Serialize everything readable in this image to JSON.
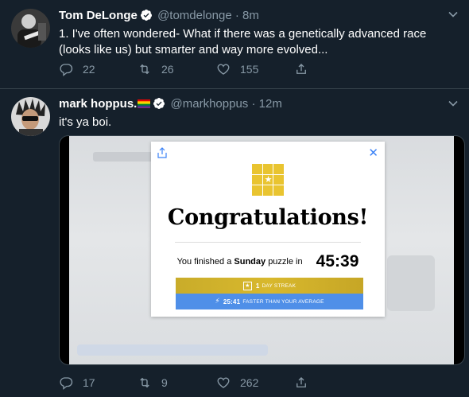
{
  "tweets": [
    {
      "name": "Tom DeLonge",
      "handle": "@tomdelonge",
      "time": "8m",
      "text": "1. I've often wondered- What if there was a genetically advanced race (looks like us) but smarter and way more evolved...",
      "replies": "22",
      "retweets": "26",
      "likes": "155"
    },
    {
      "name": "mark hoppus.",
      "handle": "@markhoppus",
      "time": "12m",
      "text": "it's ya boi.",
      "replies": "17",
      "retweets": "9",
      "likes": "262",
      "media": {
        "title": "Congratulations!",
        "finished_prefix": "You finished a",
        "day": "Sunday",
        "finished_suffix": "puzzle in",
        "solve_time": "45:39",
        "streak_count": "1",
        "streak_label": "DAY STREAK",
        "faster_time": "25:41",
        "faster_label": "FASTER THAN YOUR AVERAGE"
      }
    }
  ],
  "colors": {
    "background": "#15202b",
    "secondary_text": "#8899a6",
    "verified": "#ffffff",
    "streak_gold": "#d8b82d",
    "faster_blue": "#4f8fe8"
  }
}
